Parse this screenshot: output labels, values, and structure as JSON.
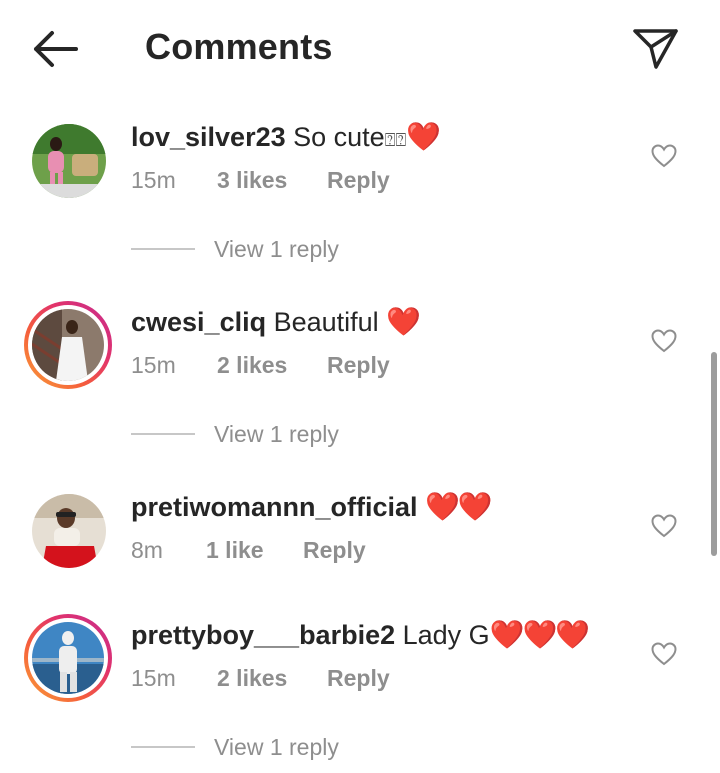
{
  "header": {
    "title": "Comments",
    "back_icon": "arrow-left-icon",
    "send_icon": "paper-plane-icon"
  },
  "comments": [
    {
      "username": "lov_silver23",
      "text": "So cute",
      "emoji_boxes": "⍰⍰",
      "hearts": "❤️",
      "time": "15m",
      "likes": "3 likes",
      "reply": "Reply",
      "view_replies": "View 1 reply"
    },
    {
      "username": "cwesi_cliq",
      "text": "Beautiful ",
      "hearts": "❤️",
      "time": "15m",
      "likes": "2 likes",
      "reply": "Reply",
      "view_replies": "View 1 reply"
    },
    {
      "username": "pretiwomannn_official",
      "text": " ",
      "hearts": "❤️❤️",
      "time": "8m",
      "likes": "1 like",
      "reply": "Reply"
    },
    {
      "username": "prettyboy___barbie2",
      "text": "Lady G",
      "hearts": "❤️❤️❤️",
      "time": "15m",
      "likes": "2 likes",
      "reply": "Reply",
      "view_replies": "View 1 reply"
    }
  ],
  "colors": {
    "text": "#262626",
    "muted": "#8e8e8e",
    "heart": "#e0112b",
    "story_ring_start": "#f9a23a",
    "story_ring_end": "#c42c91"
  }
}
